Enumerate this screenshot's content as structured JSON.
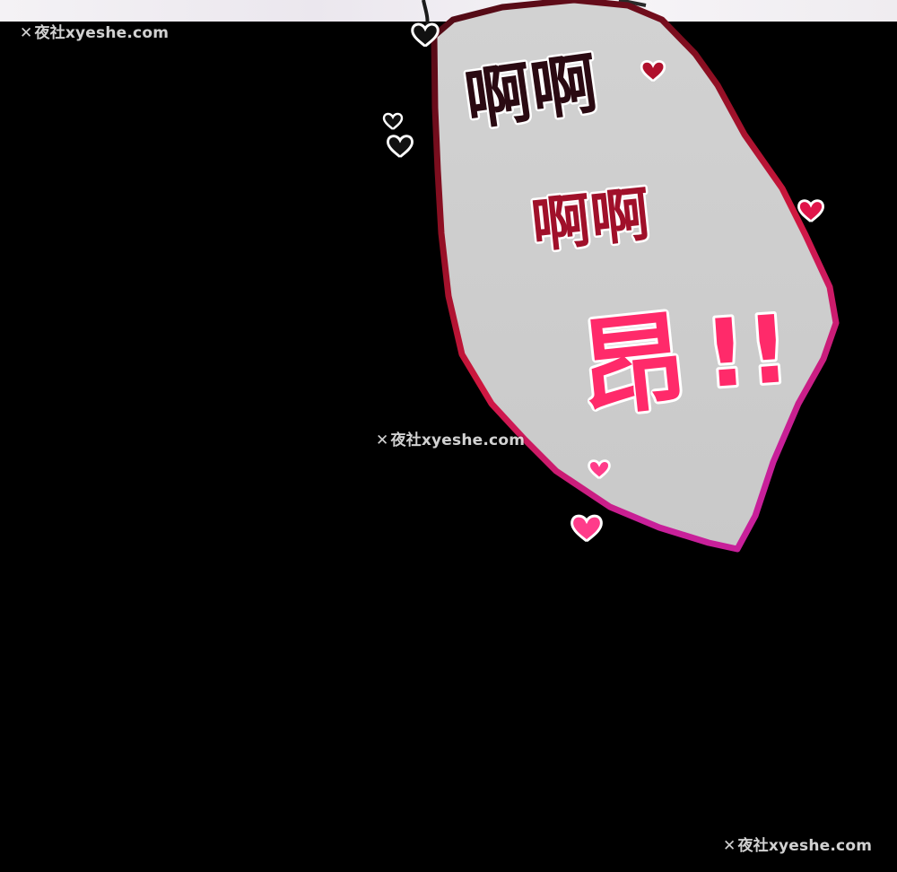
{
  "panel": {
    "background_color": "#000000",
    "bubble_fill": "#cfcfcf",
    "bubble_border_gradient": [
      "#6b0f1f",
      "#d0173f",
      "#c8209a"
    ],
    "sfx_lines": [
      "啊",
      "啊",
      "啊",
      "啊",
      "昂",
      "!!"
    ],
    "sfx_colors": {
      "line1": "#2a0a12",
      "line2": "#a0102a",
      "line3": "#ff2a6a"
    },
    "heart_icon": "heart-icon",
    "heart_colors": [
      "#2a0a10",
      "#e0154a",
      "#ff3c8a"
    ]
  },
  "watermarks": [
    {
      "icon": "✕",
      "text": "夜社xyeshe.com"
    },
    {
      "icon": "✕",
      "text": "夜社xyeshe.com"
    },
    {
      "icon": "✕",
      "text": "夜社xyeshe.com"
    }
  ]
}
